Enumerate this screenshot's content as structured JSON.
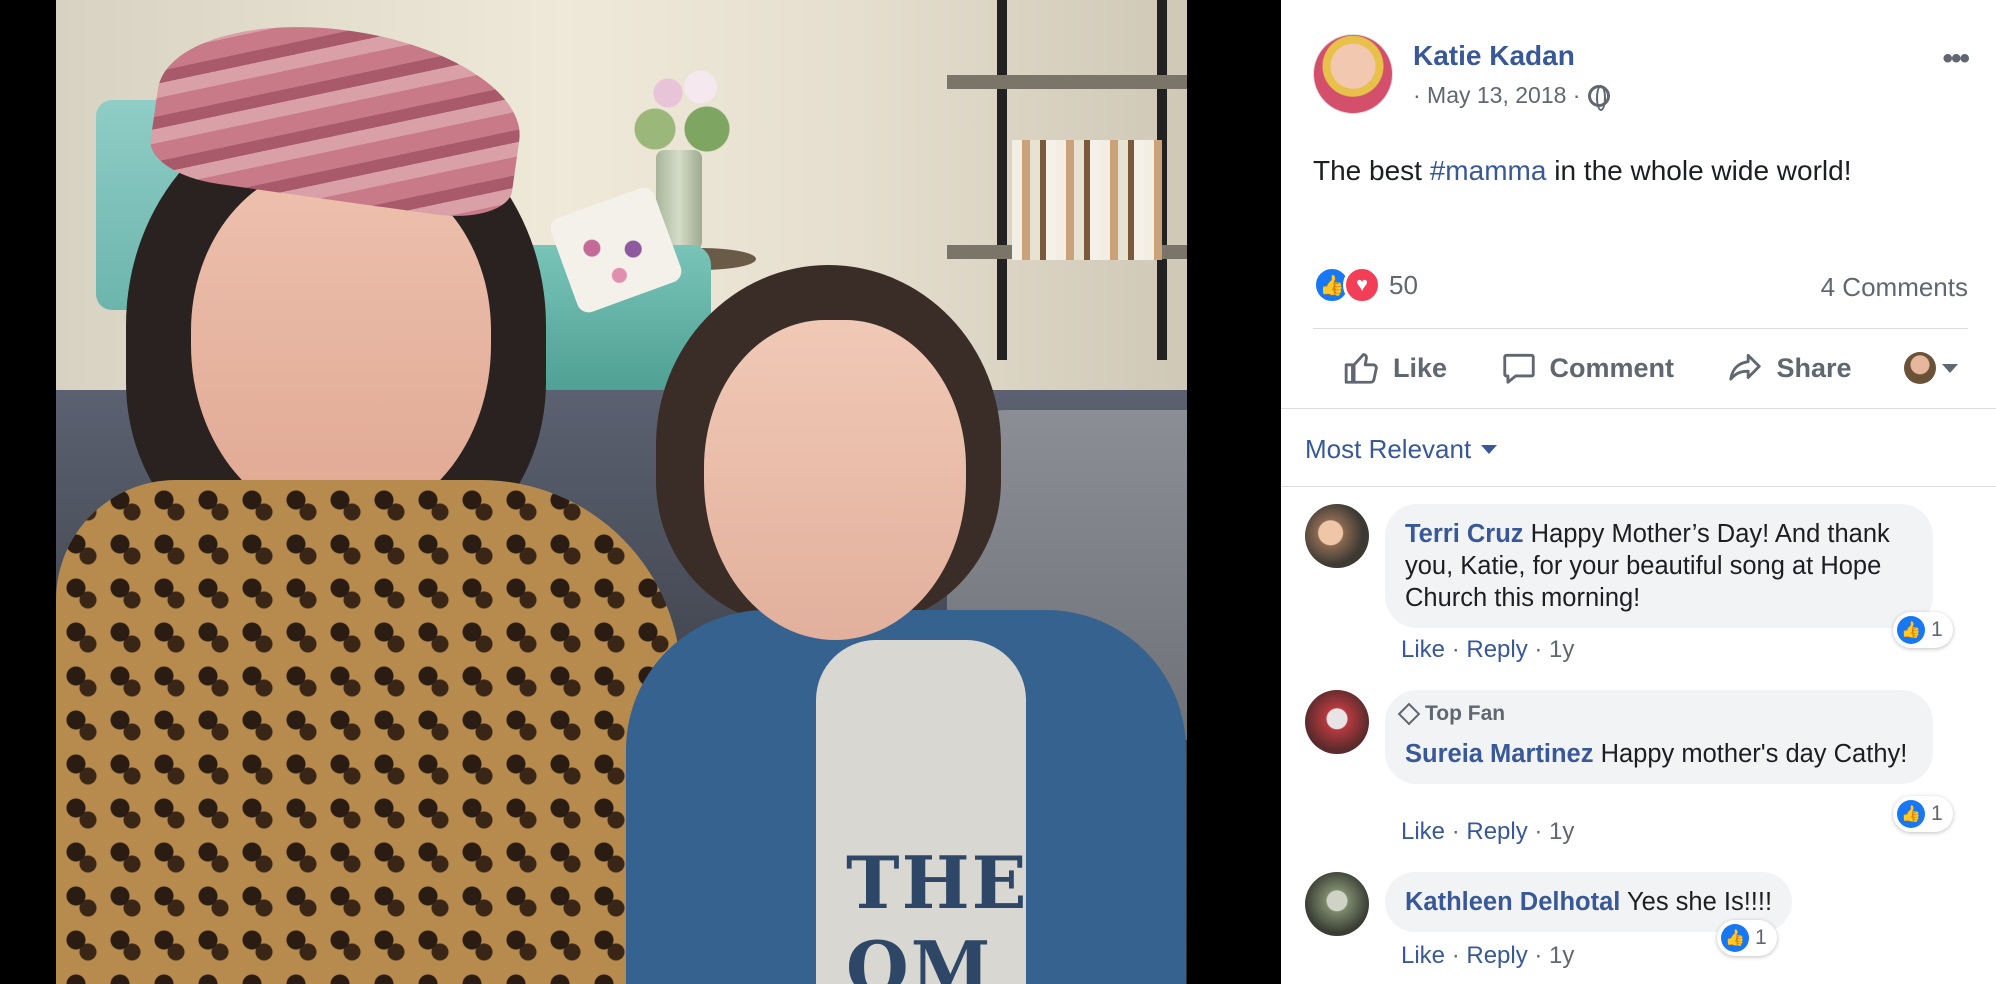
{
  "post": {
    "author": "Katie Kadan",
    "date": "· May 13, 2018 ·",
    "privacy_icon": "globe-icon",
    "text_before": "The best ",
    "hashtag": "#mamma",
    "text_after": " in the whole wide world!",
    "reaction_count": "50",
    "comments_count": "4 Comments"
  },
  "actions": {
    "like": "Like",
    "comment": "Comment",
    "share": "Share"
  },
  "sort": {
    "label": "Most Relevant"
  },
  "comments": [
    {
      "name": "Terri Cruz",
      "text": "Happy Mother’s Day! And thank you, Katie, for your beautiful song at Hope Church this morning!",
      "like": "Like",
      "reply": "Reply",
      "time": "1y",
      "likes": "1"
    },
    {
      "badge": "Top Fan",
      "name": "Sureia Martinez",
      "text": "Happy mother's day Cathy!",
      "like": "Like",
      "reply": "Reply",
      "time": "1y",
      "likes": "1"
    },
    {
      "name": "Kathleen Delhotal",
      "text": "Yes she Is!!!!",
      "like": "Like",
      "reply": "Reply",
      "time": "1y",
      "likes": "1"
    }
  ],
  "photo": {
    "shirt_text": "THE OM"
  },
  "colors": {
    "link": "#385898",
    "like_blue": "#1877f2",
    "love_red": "#f33e58",
    "bubble": "#f2f3f5"
  }
}
